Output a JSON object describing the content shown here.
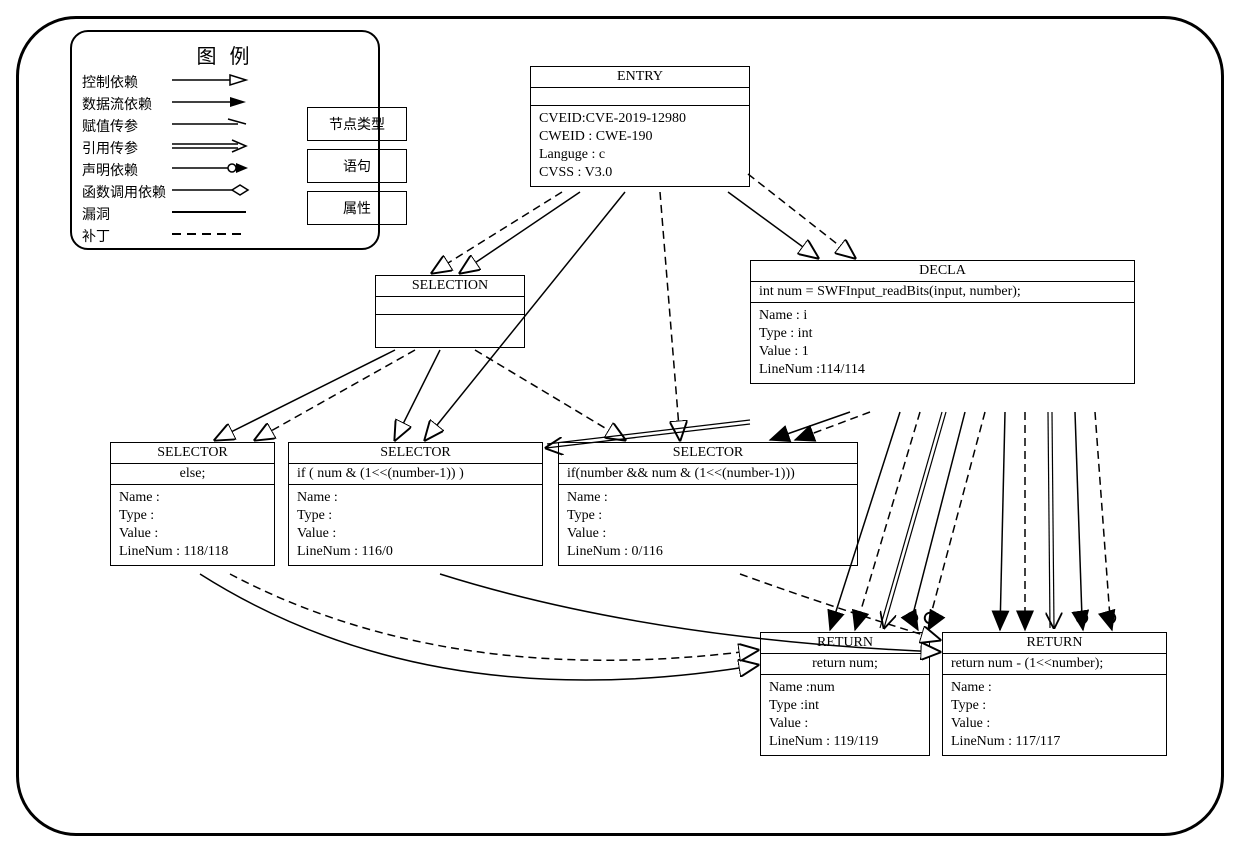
{
  "legend": {
    "title": "图 例",
    "rows": {
      "r1": "控制依赖",
      "r2": "数据流依赖",
      "r3": "赋值传参",
      "r4": "引用传参",
      "r5": "声明依赖",
      "r6": "函数调用依赖",
      "r7": "漏洞",
      "r8": "补丁"
    },
    "shapes": {
      "s1": "节点类型",
      "s2": "语句",
      "s3": "属性"
    }
  },
  "nodes": {
    "entry": {
      "head": "ENTRY",
      "stmt": "",
      "attrs": {
        "a1": "CVEID:CVE-2019-12980",
        "a2": "CWEID : CWE-190",
        "a3": "Languge : c",
        "a4": "CVSS : V3.0"
      }
    },
    "selection": {
      "head": "SELECTION",
      "stmt": "",
      "attrs": {}
    },
    "decla": {
      "head": "DECLA",
      "stmt": "int num = SWFInput_readBits(input, number);",
      "attrs": {
        "a1": "Name : i",
        "a2": "Type : int",
        "a3": "Value : 1",
        "a4": "LineNum :114/114"
      }
    },
    "sel1": {
      "head": "SELECTOR",
      "stmt": "else;",
      "attrs": {
        "a1": "Name :",
        "a2": "Type :",
        "a3": "Value :",
        "a4": "LineNum : 118/118"
      }
    },
    "sel2": {
      "head": "SELECTOR",
      "stmt": "if ( num & (1<<(number-1)) )",
      "attrs": {
        "a1": "Name :",
        "a2": "Type :",
        "a3": "Value :",
        "a4": "LineNum : 116/0"
      }
    },
    "sel3": {
      "head": "SELECTOR",
      "stmt": "if(number && num & (1<<(number-1)))",
      "attrs": {
        "a1": "Name :",
        "a2": "Type :",
        "a3": "Value :",
        "a4": "LineNum : 0/116"
      }
    },
    "ret1": {
      "head": "RETURN",
      "stmt": "return num;",
      "attrs": {
        "a1": "Name :num",
        "a2": "Type :int",
        "a3": "Value :",
        "a4": "LineNum : 119/119"
      }
    },
    "ret2": {
      "head": "RETURN",
      "stmt": "return num - (1<<number);",
      "attrs": {
        "a1": "Name :",
        "a2": "Type :",
        "a3": "Value :",
        "a4": "LineNum : 117/117"
      }
    }
  }
}
